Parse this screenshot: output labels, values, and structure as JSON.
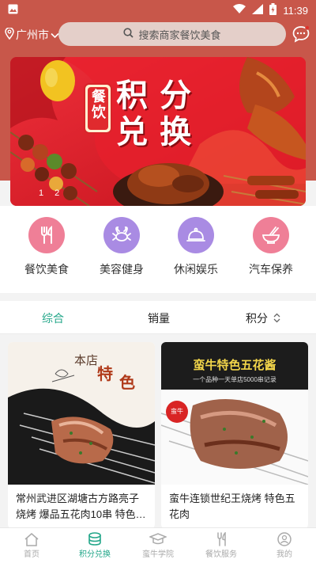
{
  "status": {
    "time": "11:39"
  },
  "header": {
    "city": "广州市",
    "search_placeholder": "搜索商家餐饮美食"
  },
  "banner": {
    "badge": "餐饮",
    "line1": "积 分",
    "line2": "兑 换",
    "dot_labels": [
      "1",
      "2"
    ]
  },
  "categories": [
    {
      "label": "餐饮美食",
      "color": "#ef7f97",
      "icon": "fork-knife-icon"
    },
    {
      "label": "美容健身",
      "color": "#a98be3",
      "icon": "crab-icon"
    },
    {
      "label": "休闲娱乐",
      "color": "#a98be3",
      "icon": "food-cover-icon"
    },
    {
      "label": "汽车保养",
      "color": "#ef7f97",
      "icon": "noodle-bowl-icon"
    }
  ],
  "sort": {
    "tab1": "综合",
    "tab2": "销量",
    "tab3": "积分"
  },
  "products": [
    {
      "title": "常州武进区湖塘古方路亮子烧烤 爆品五花肉10串 特色…",
      "img_text1": "本店",
      "img_text2": "特",
      "img_text3": "色"
    },
    {
      "title": "蛮牛连锁世纪王烧烤 特色五花肉",
      "img_headline": "蛮牛特色五花酱",
      "img_sub": "一个品种一天单店5000串记录",
      "img_badge": "蛮牛"
    }
  ],
  "nav": [
    {
      "label": "首页",
      "icon": "home-icon"
    },
    {
      "label": "积分兑换",
      "icon": "points-exchange-icon"
    },
    {
      "label": "蛮牛学院",
      "icon": "graduation-cap-icon"
    },
    {
      "label": "餐饮服务",
      "icon": "cutlery-icon"
    },
    {
      "label": "我的",
      "icon": "profile-icon"
    }
  ],
  "colors": {
    "brand": "#c8574a",
    "accent": "#24a78a"
  }
}
